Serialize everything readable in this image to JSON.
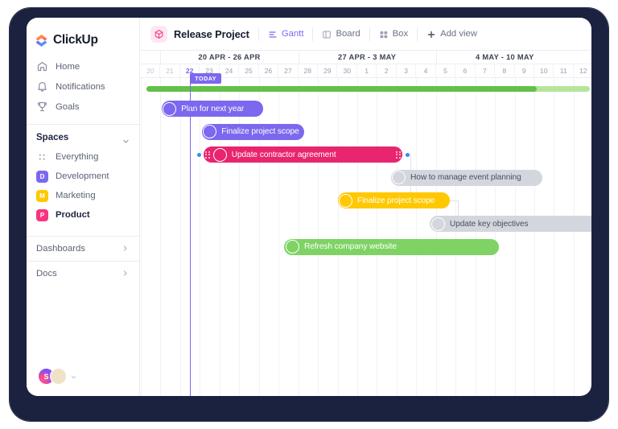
{
  "sidebar": {
    "logo_text": "ClickUp",
    "nav": [
      {
        "label": "Home",
        "icon": "home-icon"
      },
      {
        "label": "Notifications",
        "icon": "bell-icon"
      },
      {
        "label": "Goals",
        "icon": "trophy-icon"
      }
    ],
    "spaces_heading": "Spaces",
    "spaces": [
      {
        "label": "Everything",
        "badge": "",
        "color": "",
        "active": false,
        "icon": "grid-dots-icon"
      },
      {
        "label": "Development",
        "badge": "D",
        "color": "#7b68ee",
        "active": false
      },
      {
        "label": "Marketing",
        "badge": "M",
        "color": "#ffc800",
        "active": false
      },
      {
        "label": "Product",
        "badge": "P",
        "color": "#f8347f",
        "active": true
      }
    ],
    "links": [
      {
        "label": "Dashboards",
        "icon": "chevron-right-icon"
      },
      {
        "label": "Docs",
        "icon": "chevron-right-icon"
      }
    ],
    "avatars": [
      {
        "type": "initial",
        "initial": "S"
      },
      {
        "type": "photo"
      }
    ]
  },
  "topbar": {
    "project_title": "Release Project",
    "project_icon": "cube-icon",
    "views": [
      {
        "label": "Gantt",
        "icon": "gantt-icon",
        "active": true
      },
      {
        "label": "Board",
        "icon": "board-icon",
        "active": false
      },
      {
        "label": "Box",
        "icon": "box-icon",
        "active": false
      }
    ],
    "add_view_label": "Add view",
    "add_view_icon": "plus-icon"
  },
  "timeline": {
    "weeks": [
      {
        "label": "20 APR - 26 APR",
        "start_index": 1,
        "span": 7
      },
      {
        "label": "27 APR - 3 MAY",
        "start_index": 8,
        "span": 7
      },
      {
        "label": "4 MAY - 10 MAY",
        "start_index": 15,
        "span": 7
      }
    ],
    "days": [
      {
        "num": "20",
        "state": "past"
      },
      {
        "num": "21",
        "state": "past"
      },
      {
        "num": "22",
        "state": "today"
      },
      {
        "num": "23",
        "state": "normal"
      },
      {
        "num": "24",
        "state": "normal"
      },
      {
        "num": "25",
        "state": "normal"
      },
      {
        "num": "26",
        "state": "normal"
      },
      {
        "num": "27",
        "state": "normal"
      },
      {
        "num": "28",
        "state": "normal"
      },
      {
        "num": "29",
        "state": "normal"
      },
      {
        "num": "30",
        "state": "normal"
      },
      {
        "num": "1",
        "state": "normal"
      },
      {
        "num": "2",
        "state": "normal"
      },
      {
        "num": "3",
        "state": "normal"
      },
      {
        "num": "4",
        "state": "normal"
      },
      {
        "num": "5",
        "state": "normal"
      },
      {
        "num": "6",
        "state": "normal"
      },
      {
        "num": "7",
        "state": "normal"
      },
      {
        "num": "8",
        "state": "normal"
      },
      {
        "num": "9",
        "state": "normal"
      },
      {
        "num": "10",
        "state": "normal"
      },
      {
        "num": "11",
        "state": "normal"
      },
      {
        "num": "12",
        "state": "normal"
      }
    ],
    "today_label": "TODAY",
    "today_day_index": 2,
    "progress": {
      "percent": 88,
      "track_color": "#b6e59a",
      "fill_color": "#63c048"
    }
  },
  "tasks": [
    {
      "label": "Plan for next year",
      "color": "purple",
      "start_day": 1.05,
      "end_day": 6.2,
      "row": 1,
      "avatar": {
        "skin": "#7a5137",
        "hair": "#221a14",
        "body": "#3d4b60"
      },
      "selected": false
    },
    {
      "label": "Finalize project scope",
      "color": "purple",
      "start_day": 3.1,
      "end_day": 8.3,
      "row": 2,
      "avatar": {
        "skin": "#f0c6a8",
        "hair": "#e8c07a",
        "body": "#dfe3ea"
      },
      "selected": false
    },
    {
      "label": "Update contractor agreement",
      "color": "pink",
      "start_day": 3.2,
      "end_day": 13.3,
      "row": 3,
      "avatar": {
        "skin": "#f3c9ae",
        "hair": "#6b3a2a",
        "body": "#f2e8e2"
      },
      "selected": true
    },
    {
      "label": "How to manage event planning",
      "color": "grey",
      "start_day": 12.7,
      "end_day": 20.4,
      "row": 4,
      "avatar": {
        "skin": "#c08a60",
        "hair": "#2a2119",
        "body": "#8d9aa8"
      },
      "selected": false
    },
    {
      "label": "Finalize project scope",
      "color": "yellow",
      "start_day": 10.0,
      "end_day": 15.7,
      "row": 5,
      "avatar": {
        "skin": "#6b4327",
        "hair": "#140f0c",
        "body": "#efe6d8"
      },
      "selected": false
    },
    {
      "label": "Update key objectives",
      "color": "grey",
      "start_day": 14.7,
      "end_day": 23.5,
      "row": 6,
      "avatar": {
        "skin": "#d79f78",
        "hair": "#3a2a1e",
        "body": "#9aa6b4"
      },
      "selected": false
    },
    {
      "label": "Refresh company website",
      "color": "green",
      "start_day": 7.3,
      "end_day": 18.2,
      "row": 7,
      "avatar": {
        "skin": "#6a4526",
        "hair": "#15100c",
        "body": "#e8e2d6"
      },
      "selected": false
    }
  ],
  "dependencies": [
    {
      "from_task": 2,
      "to_task": 3
    },
    {
      "from_task": 2,
      "to_task": 4
    },
    {
      "from_task": 4,
      "to_task": 5
    }
  ],
  "colors": {
    "accent_purple": "#7b68ee",
    "pink": "#e8256e",
    "yellow": "#ffc800",
    "green": "#7ed364",
    "grey": "#d3d6dd",
    "frame": "#1b2240",
    "dep_dot": "#2f8ef4"
  }
}
